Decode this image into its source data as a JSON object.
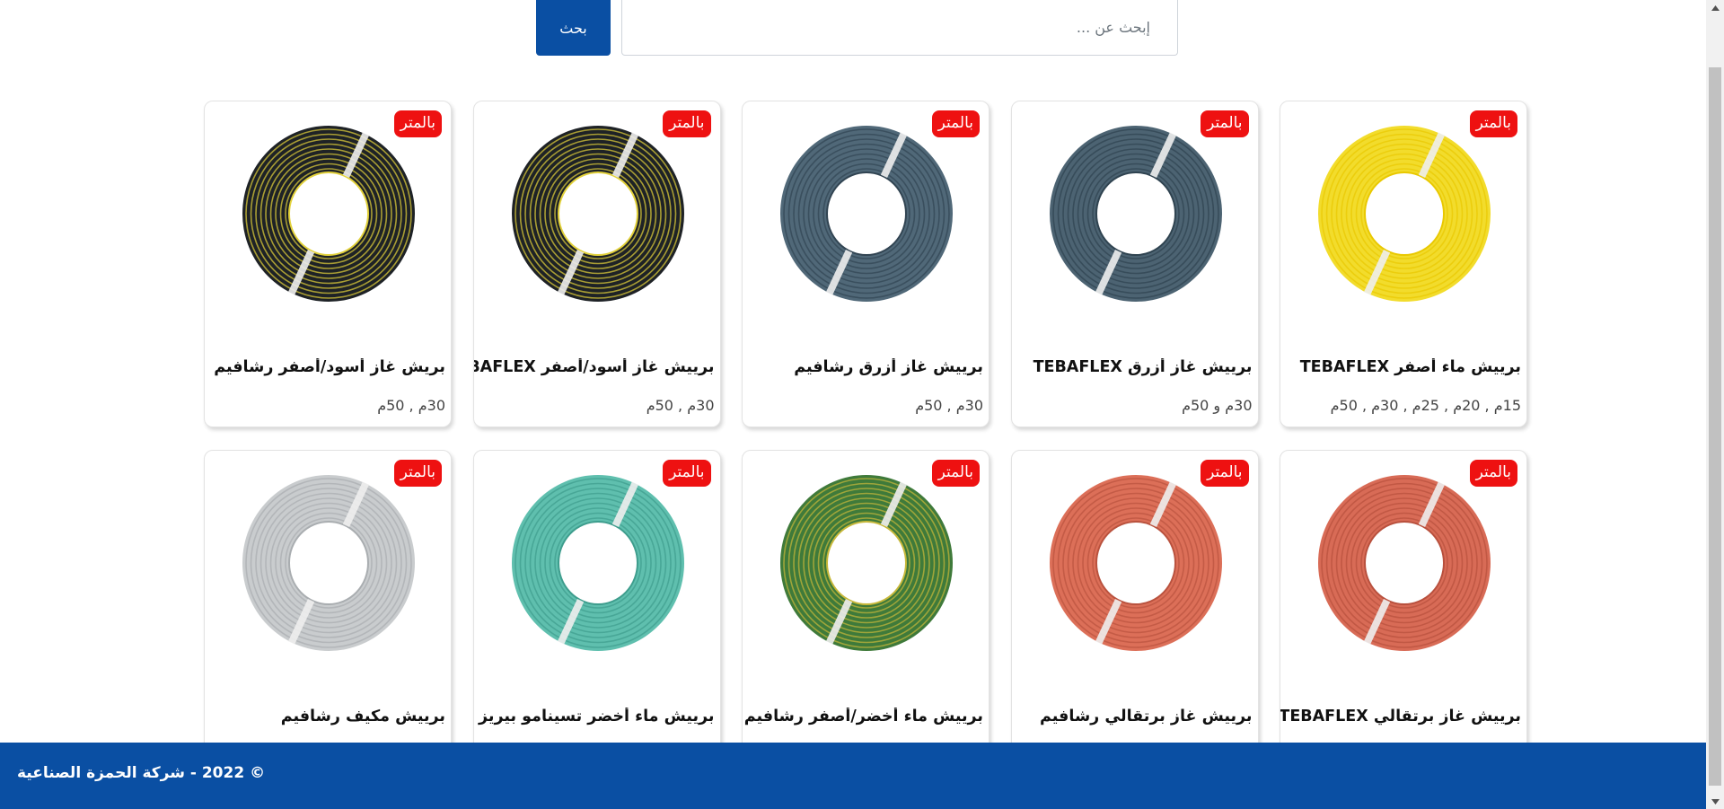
{
  "search": {
    "placeholder": "إبحث عن ...",
    "value": "",
    "button_label": "بحث"
  },
  "products": [
    {
      "badge": "بالمتر",
      "title": "برييش ماء أصفر TEBAFLEX",
      "sizes": "15م , 20م , 25م , 30م , 50م",
      "image_icon": "yellow-hose-coil-icon",
      "hose_color": "#f2dc2c",
      "stripe_color": "#e9c800"
    },
    {
      "badge": "بالمتر",
      "title": "برييش غاز أزرق TEBAFLEX",
      "sizes": "30م و 50م",
      "image_icon": "blue-gray-hose-coil-icon",
      "hose_color": "#4c6372",
      "stripe_color": "#2f4350"
    },
    {
      "badge": "بالمتر",
      "title": "برييش غاز أزرق رشافيم",
      "sizes": "30م , 50م",
      "image_icon": "blue-gray-hose-coil-icon",
      "hose_color": "#506878",
      "stripe_color": "#314452"
    },
    {
      "badge": "بالمتر",
      "title": "برييش غاز أسود/أصفر TEBAFLEX",
      "sizes": "30م , 50م",
      "image_icon": "black-yellow-hose-coil-icon",
      "hose_color": "#1e2226",
      "stripe_color": "#e2d13a"
    },
    {
      "badge": "بالمتر",
      "title": "بريش غاز أسود/أصفر رشافيم",
      "sizes": "30م , 50م",
      "image_icon": "black-yellow-hose-coil-icon",
      "hose_color": "#1e2226",
      "stripe_color": "#e2d13a"
    },
    {
      "badge": "بالمتر",
      "title": "برييش غاز برتقالي TEBAFLEX",
      "sizes": "",
      "image_icon": "orange-hose-coil-icon",
      "hose_color": "#d86b56",
      "stripe_color": "#b8503d"
    },
    {
      "badge": "بالمتر",
      "title": "برييش غاز برتقالي رشافيم",
      "sizes": "",
      "image_icon": "orange-hose-coil-icon",
      "hose_color": "#dc6f58",
      "stripe_color": "#b9523e"
    },
    {
      "badge": "بالمتر",
      "title": "برييش ماء أخضر/أصفر رشافيم",
      "sizes": "",
      "image_icon": "green-packaged-hose-coil-icon",
      "hose_color": "#3f7a3a",
      "stripe_color": "#c7b83a"
    },
    {
      "badge": "بالمتر",
      "title": "برييش ماء أخضر تسينامو بيريز",
      "sizes": "",
      "image_icon": "teal-hose-coil-icon",
      "hose_color": "#5fbfae",
      "stripe_color": "#3e9d8d"
    },
    {
      "badge": "بالمتر",
      "title": "برييش مكيف رشافيم",
      "sizes": "",
      "image_icon": "gray-corrugated-conduit-coil-icon",
      "hose_color": "#c9ccce",
      "stripe_color": "#a9adb0"
    }
  ],
  "footer": {
    "text": "© 2022 - شركة الحمزة الصناعية"
  },
  "colors": {
    "brand_blue": "#0a4fa3",
    "badge_red": "#ee1111"
  }
}
